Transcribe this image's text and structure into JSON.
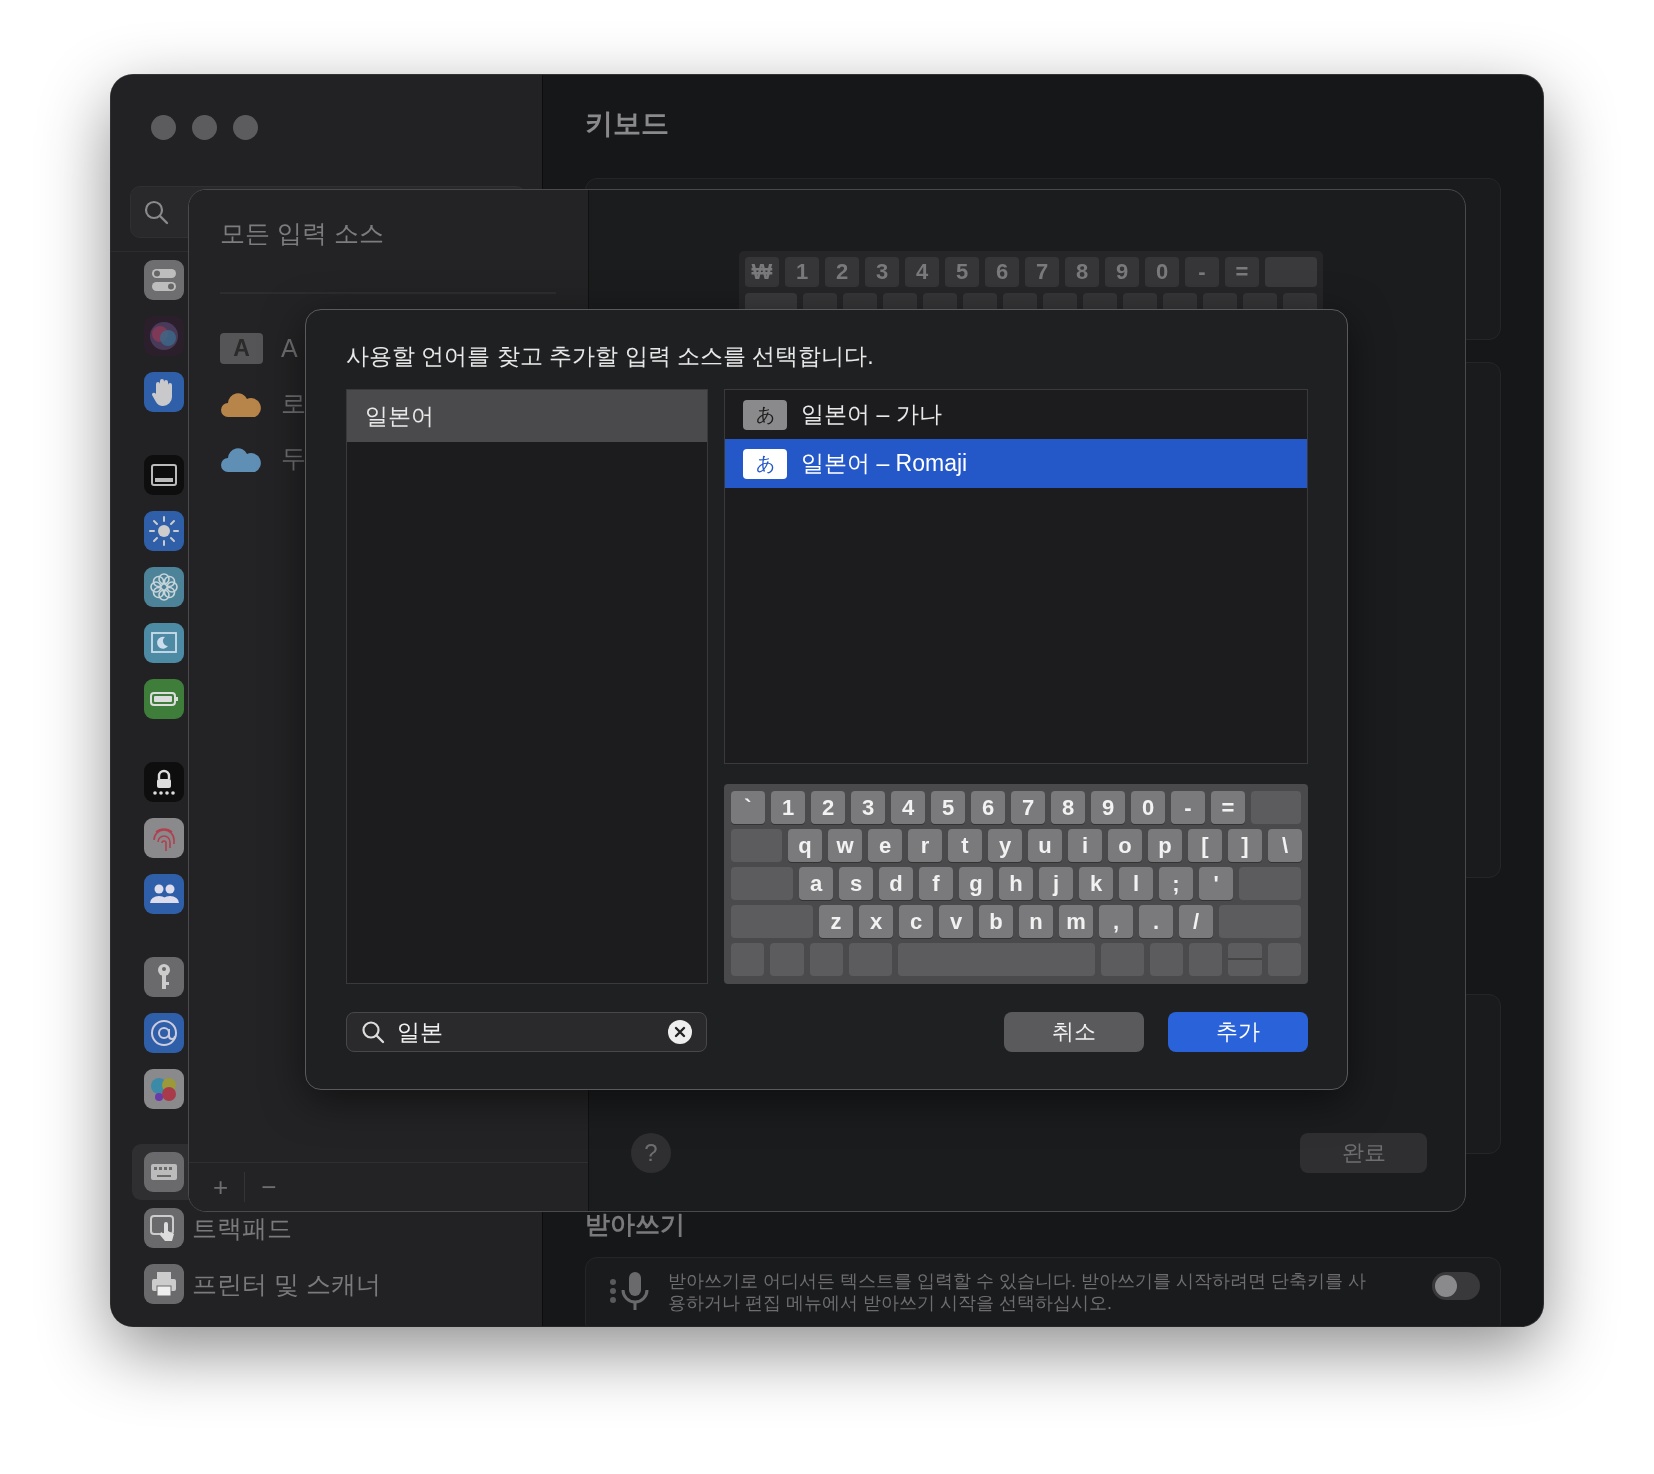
{
  "window": {
    "title": "키보드"
  },
  "sidebar": {
    "groups": [
      [
        {
          "selected": false
        },
        {
          "selected": false
        },
        {
          "selected": false
        }
      ],
      [
        {
          "selected": false
        },
        {
          "selected": false
        },
        {
          "selected": false
        },
        {
          "selected": false
        },
        {
          "selected": false
        }
      ],
      [
        {
          "selected": false
        },
        {
          "selected": false
        },
        {
          "selected": false
        }
      ],
      [
        {
          "selected": false
        },
        {
          "selected": false
        },
        {
          "selected": false
        }
      ],
      [
        {
          "selected": true
        },
        {
          "selected": false,
          "label": "트랙패드"
        },
        {
          "selected": false,
          "label": "프린터 및 스캐너"
        }
      ]
    ]
  },
  "input_sources_sheet": {
    "title": "모든 입력 소스",
    "items": [
      {
        "kind": "badge",
        "badge": "A",
        "label": "A"
      },
      {
        "kind": "cloud",
        "color": "#b7844a",
        "label": "로"
      },
      {
        "kind": "cloud",
        "color": "#5f8fb5",
        "label": "두"
      }
    ],
    "add_button": "+",
    "remove_button": "−",
    "help_button": "?",
    "done_button": "완료",
    "keyboard_preview": {
      "keys": [
        "₩",
        "1",
        "2",
        "3",
        "4",
        "5",
        "6",
        "7",
        "8",
        "9",
        "0",
        "-",
        "="
      ]
    }
  },
  "dialog": {
    "title": "사용할 언어를 찾고 추가할 입력 소스를 선택합니다.",
    "languages": [
      {
        "label": "일본어",
        "selected": true
      }
    ],
    "sources": [
      {
        "badge": "あ",
        "label": "일본어 – 가나",
        "selected": false
      },
      {
        "badge": "あ",
        "label": "일본어 – Romaji",
        "selected": true
      }
    ],
    "keyboard": {
      "rows": [
        [
          "`",
          "1",
          "2",
          "3",
          "4",
          "5",
          "6",
          "7",
          "8",
          "9",
          "0",
          "-",
          "="
        ],
        [
          "q",
          "w",
          "e",
          "r",
          "t",
          "y",
          "u",
          "i",
          "o",
          "p",
          "[",
          "]",
          "\\"
        ],
        [
          "a",
          "s",
          "d",
          "f",
          "g",
          "h",
          "j",
          "k",
          "l",
          ";",
          "'"
        ],
        [
          "z",
          "x",
          "c",
          "v",
          "b",
          "n",
          "m",
          ",",
          ".",
          "/"
        ]
      ]
    },
    "search": {
      "value": "일본"
    },
    "buttons": [
      {
        "label": "취소",
        "kind": "default"
      },
      {
        "label": "추가",
        "kind": "primary"
      }
    ]
  },
  "dictation": {
    "heading": "받아쓰기",
    "description": "받아쓰기로 어디서든 텍스트를 입력할 수 있습니다. 받아쓰기를 시작하려면 단축키를 사용하거나 편집 메뉴에서 받아쓰기 시작을 선택하십시오.",
    "on": false
  }
}
